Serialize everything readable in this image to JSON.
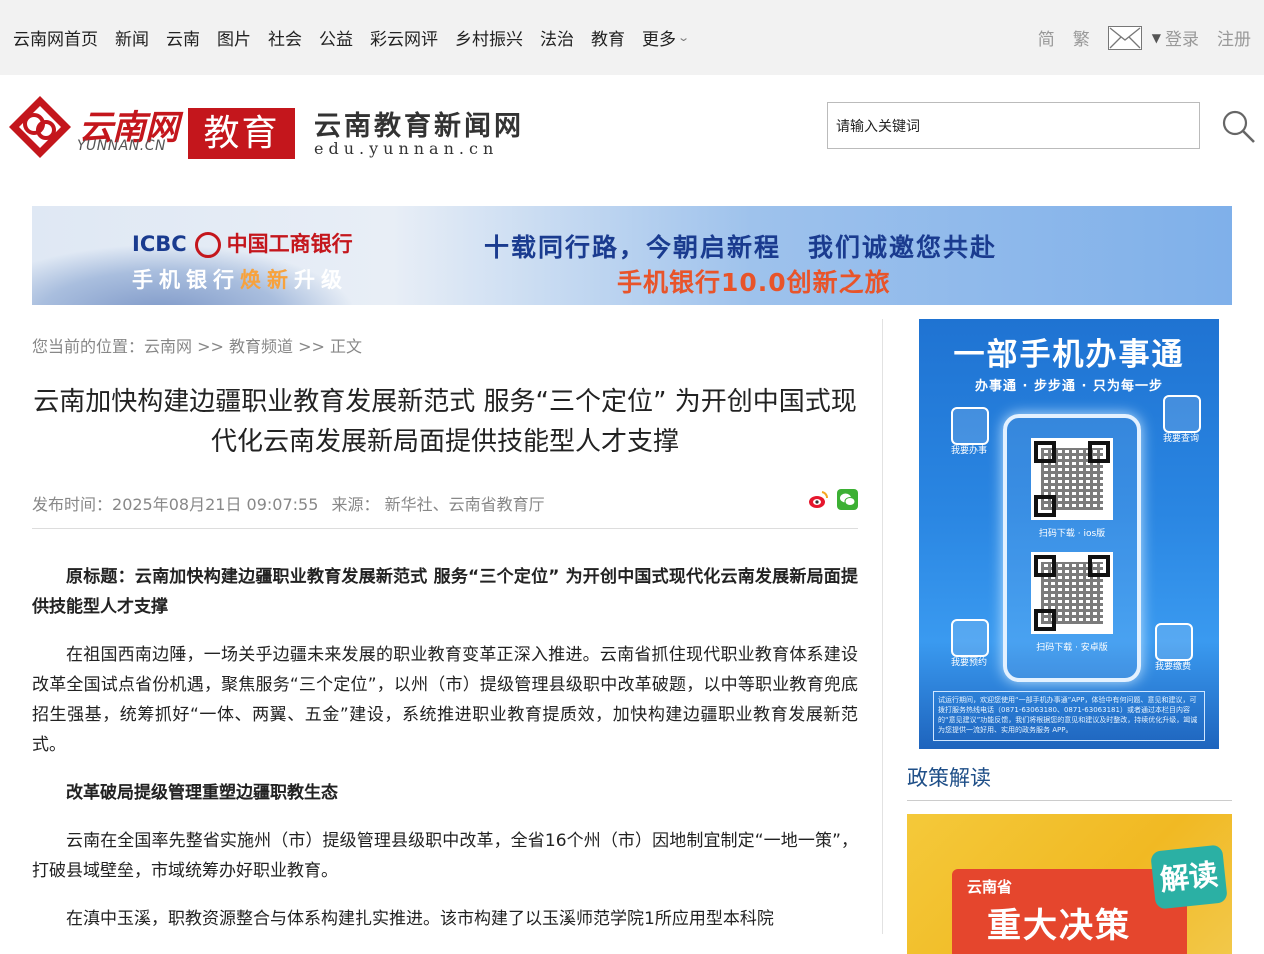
{
  "nav": {
    "items": [
      "云南网首页",
      "新闻",
      "云南",
      "图片",
      "社会",
      "公益",
      "彩云网评",
      "乡村振兴",
      "法治",
      "教育"
    ],
    "more": "更多",
    "simplified": "简",
    "traditional": "繁",
    "login": "登录",
    "register": "注册"
  },
  "header": {
    "brand": "云南网",
    "brand_en": "YUNNAN.CN",
    "channel": "教育",
    "site_name": "云南教育新闻网",
    "site_url": "edu.yunnan.cn"
  },
  "search": {
    "placeholder": "请输入关键词"
  },
  "banner": {
    "bank_en": "ICBC",
    "bank_cn": "中国工商银行",
    "upgrade_a": "手机银行",
    "upgrade_hl": "焕新",
    "upgrade_b": "升级",
    "slogan": "十载同行路，今朝启新程　我们诚邀您共赴",
    "slogan2": "手机银行10.0创新之旅"
  },
  "breadcrumb": {
    "prefix": "您当前的位置：",
    "home": "云南网",
    "sep1": " >> ",
    "channel": "教育频道",
    "sep2": " >> ",
    "current": "正文"
  },
  "article": {
    "title": "云南加快构建边疆职业教育发展新范式 服务“三个定位” 为开创中国式现代化云南发展新局面提供技能型人才支撑",
    "publish_label": "发布时间：",
    "publish_time": "2025年08月21日 09:07:55",
    "source_label": "来源：",
    "source": "新华社、云南省教育厅",
    "paragraphs": [
      "原标题：云南加快构建边疆职业教育发展新范式 服务“三个定位” 为开创中国式现代化云南发展新局面提供技能型人才支撑",
      "在祖国西南边陲，一场关乎边疆未来发展的职业教育变革正深入推进。云南省抓住现代职业教育体系建设改革全国试点省份机遇，聚焦服务“三个定位”，以州（市）提级管理县级职中改革破题，以中等职业教育兜底招生强基，统筹抓好“一体、两翼、五金”建设，系统推进职业教育提质效，加快构建边疆职业教育发展新范式。",
      "改革破局提级管理重塑边疆职教生态",
      "云南在全国率先整省实施州（市）提级管理县级职中改革，全省16个州（市）因地制宜制定“一地一策”，打破县域壁垒，市域统筹办好职业教育。",
      "在滇中玉溪，职教资源整合与体系构建扎实推进。该市构建了以玉溪师范学院1所应用型本科院"
    ]
  },
  "poster": {
    "title": "一部手机办事通",
    "subtitle": "办事通 · 步步通 · 只为每一步",
    "tile1": "我要办事",
    "tile2": "我要查询",
    "tile3": "我要预约",
    "tile4": "我要缴费",
    "qr1": "扫码下载 · ios版",
    "qr2": "扫码下载 · 安卓版",
    "foot": "试运行期间，欢迎您使用“一部手机办事通”APP，体验中有何问题、意见和建议，可拨打服务热线电话（0871-63063180、0871-63063181）或者通过本栏目内容的“意见建议”功能反馈，我们将根据您的意见和建议及时整改，持续优化升级，竭诚为您提供一流好用、实用的政务服务 APP。"
  },
  "sidebar": {
    "section_title": "政策解读",
    "card_province": "云南省",
    "card_big": "重大决策",
    "card_badge": "解读"
  }
}
